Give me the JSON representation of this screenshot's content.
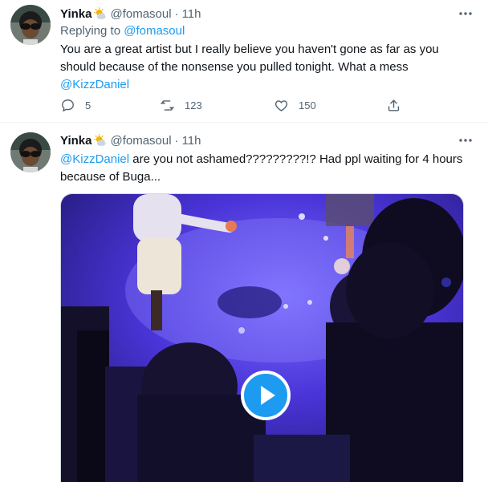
{
  "tweets": [
    {
      "user": {
        "name": "Yinka",
        "handle": "@fomasoul",
        "time": "11h",
        "separator": "·"
      },
      "replying_prefix": "Replying to ",
      "replying_to": "@fomasoul",
      "text": "You are a great artist but I really believe you haven't gone as far as you should because of the nonsense you pulled tonight. What a mess",
      "text_mention": "@KizzDaniel",
      "actions": {
        "replies": "5",
        "retweets": "123",
        "likes": "150"
      }
    },
    {
      "user": {
        "name": "Yinka",
        "handle": "@fomasoul",
        "time": "11h",
        "separator": "·"
      },
      "text_mention": "@KizzDaniel",
      "text_rest": " are you not ashamed?????????!?  Had ppl waiting for 4 hours because of Buga...",
      "media": {
        "type": "video",
        "play_icon": "play-icon"
      }
    }
  ],
  "colors": {
    "accent": "#1d9bf0",
    "text": "#0f1419",
    "muted": "#536471"
  }
}
